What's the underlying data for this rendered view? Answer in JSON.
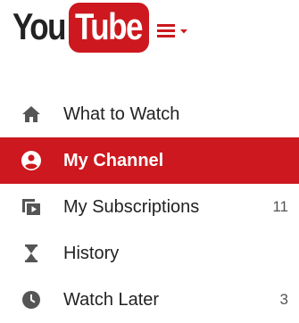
{
  "logo": {
    "you": "You",
    "tube": "Tube",
    "accent": "#cc181e"
  },
  "header": {
    "menu_icon": "hamburger-menu-icon"
  },
  "nav": {
    "items": [
      {
        "label": "What to Watch",
        "icon": "home-icon",
        "count": ""
      },
      {
        "label": "My Channel",
        "icon": "user-circle-icon",
        "count": "",
        "active": true
      },
      {
        "label": "My Subscriptions",
        "icon": "subscriptions-icon",
        "count": "11"
      },
      {
        "label": "History",
        "icon": "hourglass-icon",
        "count": ""
      },
      {
        "label": "Watch Later",
        "icon": "clock-icon",
        "count": "3"
      }
    ]
  },
  "colors": {
    "active_bg": "#cc181e",
    "text": "#222222",
    "icon": "#555555",
    "count": "#555555"
  }
}
